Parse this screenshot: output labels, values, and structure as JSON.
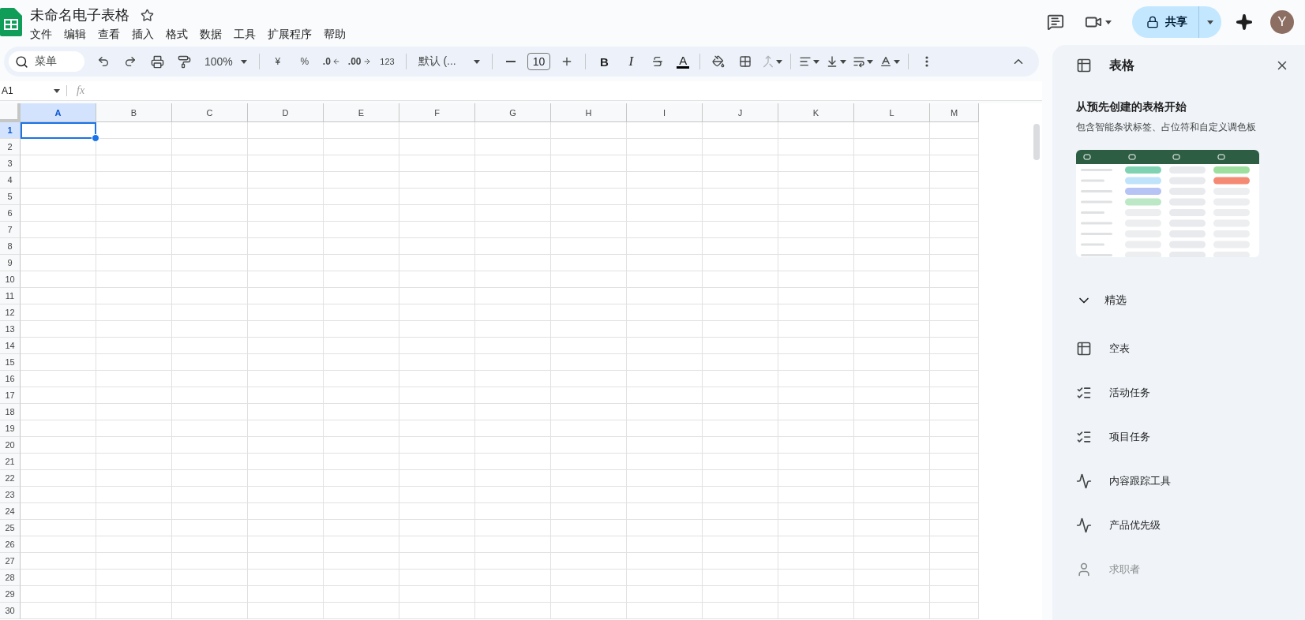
{
  "document": {
    "title": "未命名电子表格",
    "starred": false
  },
  "menus": [
    "文件",
    "编辑",
    "查看",
    "插入",
    "格式",
    "数据",
    "工具",
    "扩展程序",
    "帮助"
  ],
  "header_actions": {
    "share": "共享",
    "avatar": "Y"
  },
  "toolbar": {
    "search_placeholder": "菜单",
    "zoom": "100%",
    "currency": "¥",
    "percent": "%",
    "decrease_decimal": ".0",
    "increase_decimal": ".00",
    "number_format": "123",
    "font": "默认 (...",
    "font_size": "10",
    "bold": "B",
    "italic": "I",
    "text_color": "A"
  },
  "formula_bar": {
    "name_box": "A1",
    "fx": "fx"
  },
  "grid": {
    "columns": [
      {
        "label": "A",
        "selected": true
      },
      {
        "label": "B",
        "selected": false
      },
      {
        "label": "C",
        "selected": false
      },
      {
        "label": "D",
        "selected": false
      },
      {
        "label": "E",
        "selected": false
      },
      {
        "label": "F",
        "selected": false
      },
      {
        "label": "G",
        "selected": false
      },
      {
        "label": "H",
        "selected": false
      },
      {
        "label": "I",
        "selected": false
      },
      {
        "label": "J",
        "selected": false
      },
      {
        "label": "K",
        "selected": false
      },
      {
        "label": "L",
        "selected": false
      },
      {
        "label": "M",
        "selected": false
      }
    ],
    "rows": [
      {
        "label": "1",
        "selected": true
      },
      {
        "label": "2",
        "selected": false
      },
      {
        "label": "3",
        "selected": false
      },
      {
        "label": "4",
        "selected": false
      },
      {
        "label": "5",
        "selected": false
      },
      {
        "label": "6",
        "selected": false
      },
      {
        "label": "7",
        "selected": false
      },
      {
        "label": "8",
        "selected": false
      },
      {
        "label": "9",
        "selected": false
      },
      {
        "label": "10",
        "selected": false
      },
      {
        "label": "11",
        "selected": false
      },
      {
        "label": "12",
        "selected": false
      },
      {
        "label": "13",
        "selected": false
      },
      {
        "label": "14",
        "selected": false
      },
      {
        "label": "15",
        "selected": false
      },
      {
        "label": "16",
        "selected": false
      },
      {
        "label": "17",
        "selected": false
      },
      {
        "label": "18",
        "selected": false
      },
      {
        "label": "19",
        "selected": false
      },
      {
        "label": "20",
        "selected": false
      },
      {
        "label": "21",
        "selected": false
      },
      {
        "label": "22",
        "selected": false
      },
      {
        "label": "23",
        "selected": false
      },
      {
        "label": "24",
        "selected": false
      },
      {
        "label": "25",
        "selected": false
      },
      {
        "label": "26",
        "selected": false
      },
      {
        "label": "27",
        "selected": false
      },
      {
        "label": "28",
        "selected": false
      },
      {
        "label": "29",
        "selected": false
      },
      {
        "label": "30",
        "selected": false
      }
    ]
  },
  "side_panel": {
    "title": "表格",
    "heading": "从预先创建的表格开始",
    "subheading": "包含智能条状标签、占位符和自定义调色板",
    "section": {
      "label": "精选",
      "expanded": true,
      "items": [
        {
          "kind": "table",
          "label": "空表"
        },
        {
          "kind": "checklist",
          "label": "活动任务"
        },
        {
          "kind": "checklist",
          "label": "项目任务"
        },
        {
          "kind": "trend",
          "label": "内容跟踪工具"
        },
        {
          "kind": "trend",
          "label": "产品优先级"
        },
        {
          "kind": "person",
          "label": "求职者"
        }
      ]
    }
  }
}
